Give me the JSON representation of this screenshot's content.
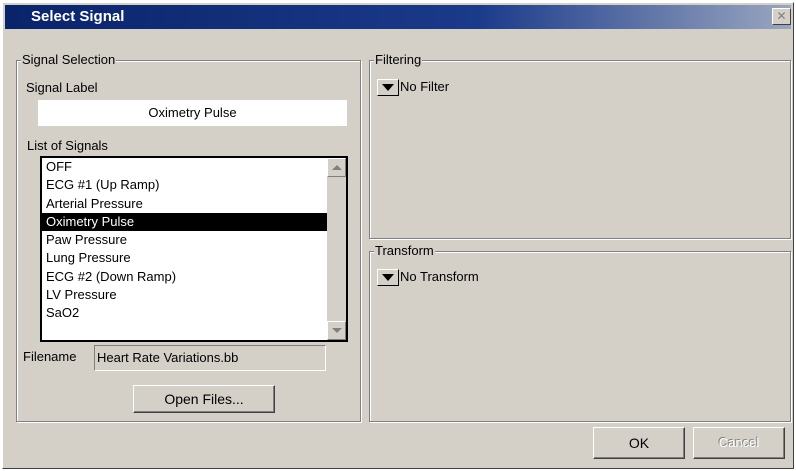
{
  "window": {
    "title": "Select Signal",
    "close_label": "✕"
  },
  "signal_selection": {
    "group_label": "Signal Selection",
    "signal_label_caption": "Signal Label",
    "signal_label_value": "Oximetry Pulse",
    "list_caption": "List of Signals",
    "signals": [
      "OFF",
      "ECG #1 (Up Ramp)",
      "Arterial Pressure",
      "Oximetry Pulse",
      "Paw Pressure",
      "Lung Pressure",
      "ECG #2 (Down Ramp)",
      "LV Pressure",
      "SaO2"
    ],
    "selected_index": 3,
    "filename_caption": "Filename",
    "filename_value": "Heart Rate Variations.bb",
    "open_files_label": "Open Files..."
  },
  "filtering": {
    "group_label": "Filtering",
    "value": "No Filter",
    "dropdown_icon": "triangle-down"
  },
  "transform": {
    "group_label": "Transform",
    "value": "No Transform",
    "dropdown_icon": "triangle-down"
  },
  "buttons": {
    "ok_label": "OK",
    "cancel_label": "Cancel"
  }
}
